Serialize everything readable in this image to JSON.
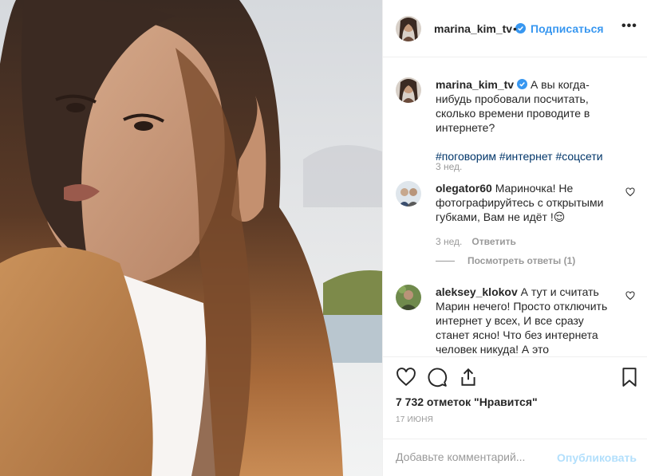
{
  "post": {
    "author": "marina_kim_tv",
    "follow_label": "Подписаться",
    "separator": "•",
    "more_label": "•••",
    "caption": "А вы когда-нибудь пробовали посчитать, сколько времени проводите в интернете?",
    "hashtags": "#поговорим #интернет #соцсети",
    "caption_age": "3 нед.",
    "likes_text": "7 732 отметок \"Нравится\"",
    "date": "17 ИЮНЯ",
    "comment_placeholder": "Добавьте комментарий...",
    "publish_label": "Опубликовать"
  },
  "comments": [
    {
      "author": "olegator60",
      "text": "Мариночка! Не фотографируйтесь с открытыми губками, Вам не идёт !😌",
      "age": "3 нед.",
      "reply_label": "Ответить",
      "view_replies": "Посмотреть ответы (1)"
    },
    {
      "author": "aleksey_klokov",
      "text": "А тут и считать Марин нечего! Просто отключить интернет у всех, И все сразу станет ясно! Что без интернета человек никуда! А это"
    }
  ],
  "icons": {
    "verified": "verified-badge-icon",
    "like": "heart-icon",
    "comment": "comment-bubble-icon",
    "share": "share-icon",
    "save": "bookmark-icon",
    "comment_like": "small-heart-icon"
  },
  "colors": {
    "link_blue": "#3897f0",
    "hashtag": "#003569",
    "muted": "#999999",
    "text": "#262626",
    "publish_disabled": "#b2dffc"
  }
}
